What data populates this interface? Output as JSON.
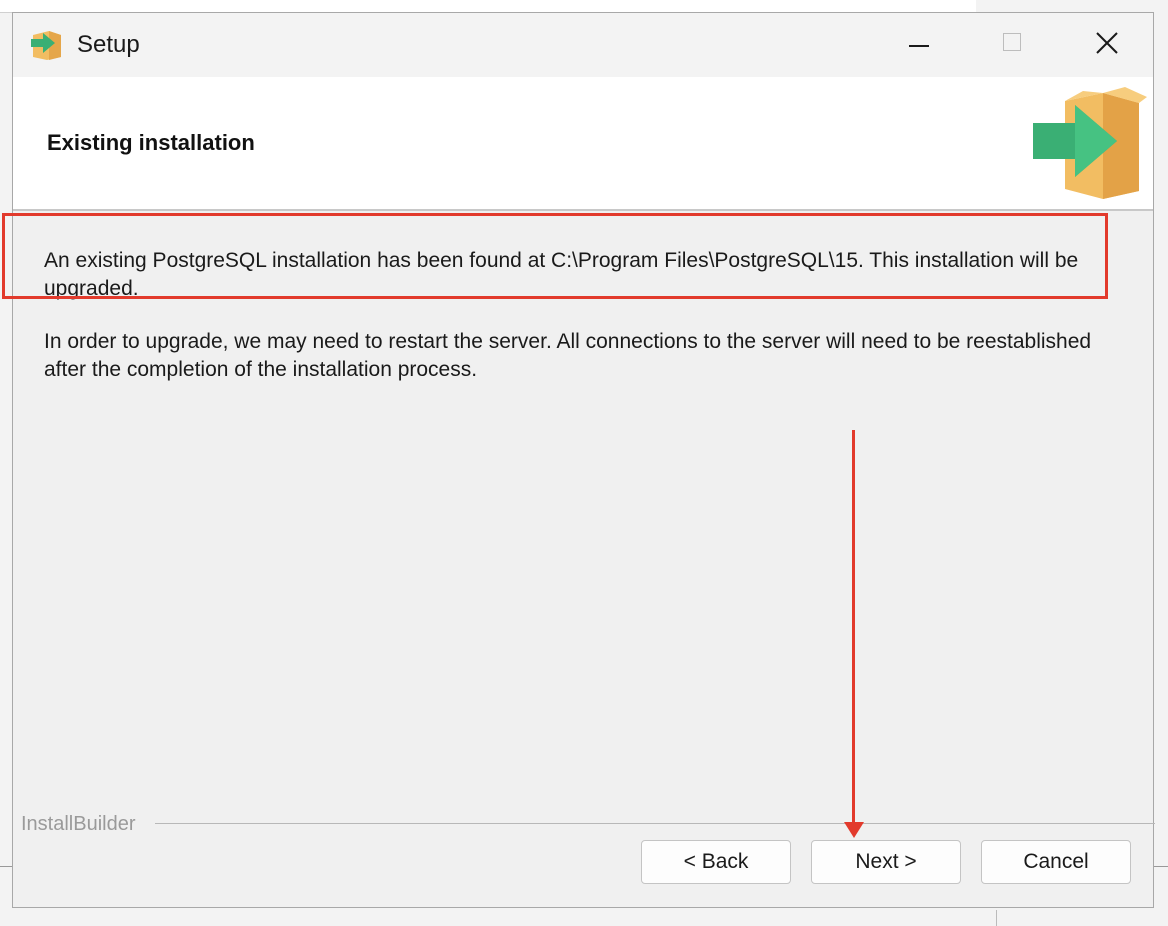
{
  "window": {
    "title": "Setup",
    "icon": "installer-box-icon",
    "controls": [
      "minimize-icon",
      "maximize-icon",
      "close-icon"
    ]
  },
  "header": {
    "title": "Existing installation",
    "icon": "installer-box-arrow-icon"
  },
  "content": {
    "message1": "An existing PostgreSQL installation has been found at C:\\Program Files\\PostgreSQL\\15. This installation will be upgraded.",
    "message2": "In order to upgrade, we may need to restart the server. All connections to the server will need to be reestablished after the completion of the installation process."
  },
  "footer": {
    "brand": "InstallBuilder",
    "buttons": {
      "back": "< Back",
      "next": "Next >",
      "cancel": "Cancel"
    }
  },
  "annotations": {
    "highlight_color": "#e23a2c"
  },
  "colors": {
    "box_tan": "#f2bd62",
    "arrow_green": "#3aaf74"
  }
}
